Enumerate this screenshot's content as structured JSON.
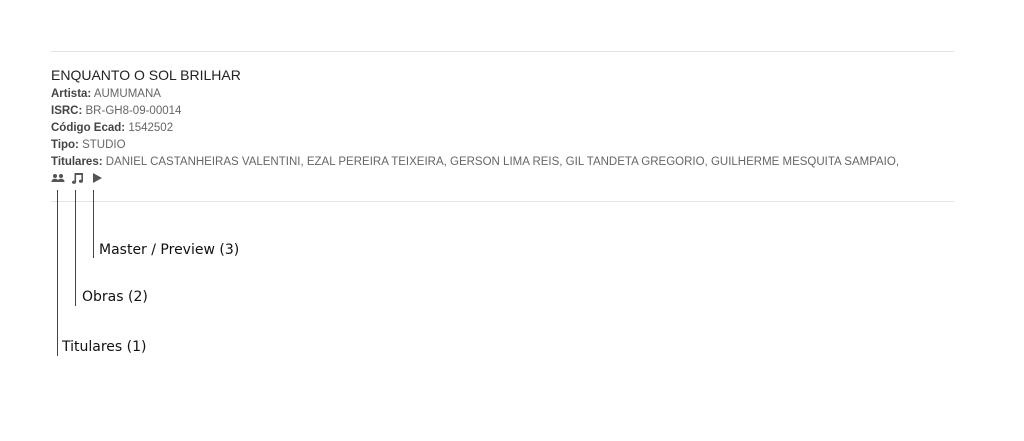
{
  "record": {
    "title": "ENQUANTO O SOL BRILHAR",
    "fields": [
      {
        "label": "Artista:",
        "value": "AUMUMANA"
      },
      {
        "label": "ISRC:",
        "value": "BR-GH8-09-00014"
      },
      {
        "label": "Código Ecad:",
        "value": "1542502"
      },
      {
        "label": "Tipo:",
        "value": "STUDIO"
      },
      {
        "label": "Titulares:",
        "value": "DANIEL CASTANHEIRAS VALENTINI, EZAL PEREIRA TEIXEIRA, GERSON LIMA REIS, GIL TANDETA GREGORIO, GUILHERME MESQUITA SAMPAIO,"
      }
    ],
    "icons": [
      "people-icon",
      "music-note-icon",
      "play-icon"
    ]
  },
  "annotations": [
    {
      "label": "Master / Preview (3)"
    },
    {
      "label": "Obras (2)"
    },
    {
      "label": "Titulares (1)"
    }
  ],
  "colors": {
    "icon": "#555555",
    "divider": "#e4e4e4",
    "annotation_line": "#444444"
  }
}
